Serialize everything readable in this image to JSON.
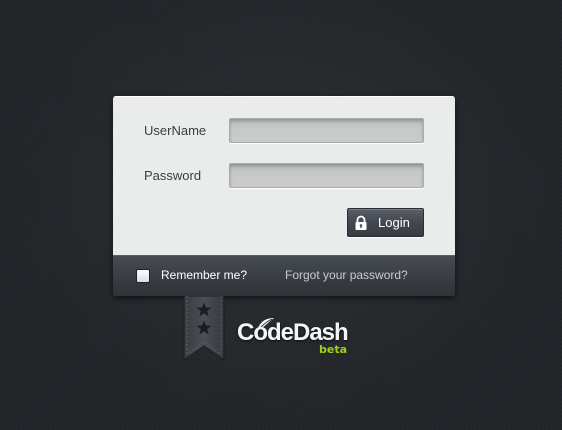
{
  "login_form": {
    "username_label": "UserName",
    "username_value": "",
    "password_label": "Password",
    "password_value": "",
    "login_button_label": "Login",
    "login_button_icon": "lock-icon"
  },
  "footer": {
    "remember_label": "Remember me?",
    "remember_checked": false,
    "forgot_link": "Forgot your password?"
  },
  "branding": {
    "name": "CodeDash",
    "tagline": "beta",
    "ribbon_icon": "star-icon",
    "accent_color": "#9dd31f"
  },
  "colors": {
    "background": "#222529",
    "panel": "#eceded",
    "footer_bar": "#3a3e45",
    "button": "#43474f"
  }
}
